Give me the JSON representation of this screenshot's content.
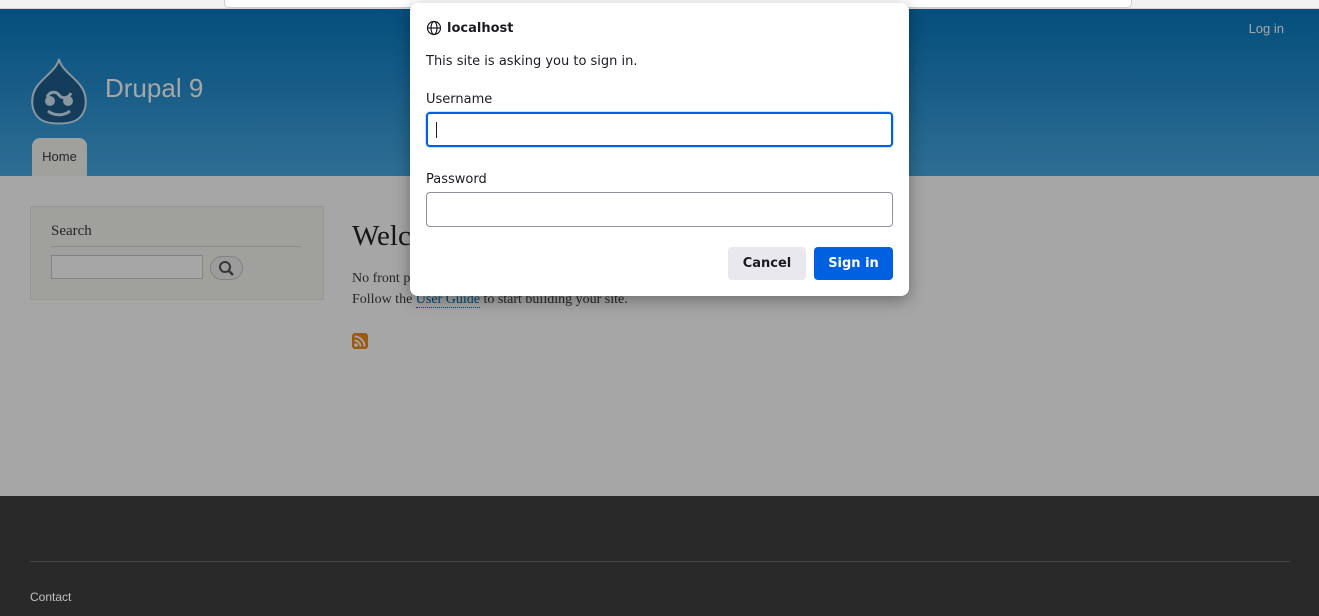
{
  "header": {
    "login_link": "Log in",
    "site_name": "Drupal 9",
    "primary_tab": "Home"
  },
  "sidebar": {
    "search_title": "Search",
    "search_value": ""
  },
  "content": {
    "title_visible": "Welc",
    "line1_visible": "No front p",
    "line2_prefix": "Follow the ",
    "line2_link": "User Guide",
    "line2_suffix": " to start building your site."
  },
  "footer": {
    "contact_link": "Contact"
  },
  "auth_dialog": {
    "host": "localhost",
    "message": "This site is asking you to sign in.",
    "username_label": "Username",
    "username_value": "",
    "password_label": "Password",
    "password_value": "",
    "cancel_label": "Cancel",
    "signin_label": "Sign in"
  },
  "colors": {
    "header_start": "#0779bf",
    "header_end": "#48a9e4",
    "primary_button": "#0061e0",
    "footer_bg": "#292929",
    "feed_icon": "#f0891e"
  },
  "icons": {
    "logo": "drupal-drop-icon",
    "search": "magnifier-icon",
    "feed": "rss-feed-icon",
    "dialog": "globe-icon"
  }
}
